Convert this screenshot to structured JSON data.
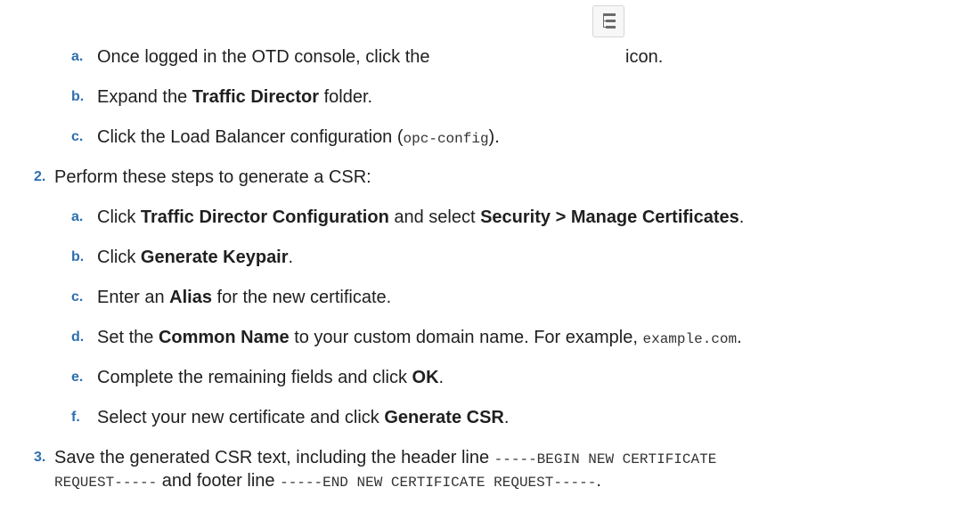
{
  "steps": {
    "s1a": {
      "marker": "a.",
      "before": "Once logged in the OTD console, click the",
      "after": "icon.",
      "icon": "tree-view-icon"
    },
    "s1b": {
      "marker": "b.",
      "t1": "Expand the ",
      "b1": "Traffic Director",
      "t2": " folder."
    },
    "s1c": {
      "marker": "c.",
      "t1": "Click the Load Balancer configuration (",
      "code": "opc-config",
      "t2": ")."
    },
    "s2": {
      "marker": "2.",
      "t1": "Perform these steps to generate a CSR:"
    },
    "s2a": {
      "marker": "a.",
      "t1": "Click ",
      "b1": "Traffic Director Configuration",
      "t2": " and select ",
      "b2": "Security > Manage Certificates",
      "t3": "."
    },
    "s2b": {
      "marker": "b.",
      "t1": "Click ",
      "b1": "Generate Keypair",
      "t2": "."
    },
    "s2c": {
      "marker": "c.",
      "t1": "Enter an ",
      "b1": "Alias",
      "t2": " for the new certificate."
    },
    "s2d": {
      "marker": "d.",
      "t1": "Set the ",
      "b1": "Common Name",
      "t2": " to your custom domain name. For example, ",
      "code": "example.com",
      "t3": "."
    },
    "s2e": {
      "marker": "e.",
      "t1": "Complete the remaining fields and click ",
      "b1": "OK",
      "t2": "."
    },
    "s2f": {
      "marker": "f.",
      "t1": "Select your new certificate and click ",
      "b1": "Generate CSR",
      "t2": "."
    },
    "s3": {
      "marker": "3.",
      "t1": "Save the generated CSR text, including the header line ",
      "code1a": "-----BEGIN NEW CERTIFICATE",
      "code1b": "REQUEST-----",
      "t2": " and footer line ",
      "code2": "-----END NEW CERTIFICATE REQUEST-----",
      "t3": "."
    }
  },
  "colors": {
    "marker": "#2d6eb0",
    "text": "#1f1f1f",
    "icon": "#6b6b6b"
  }
}
